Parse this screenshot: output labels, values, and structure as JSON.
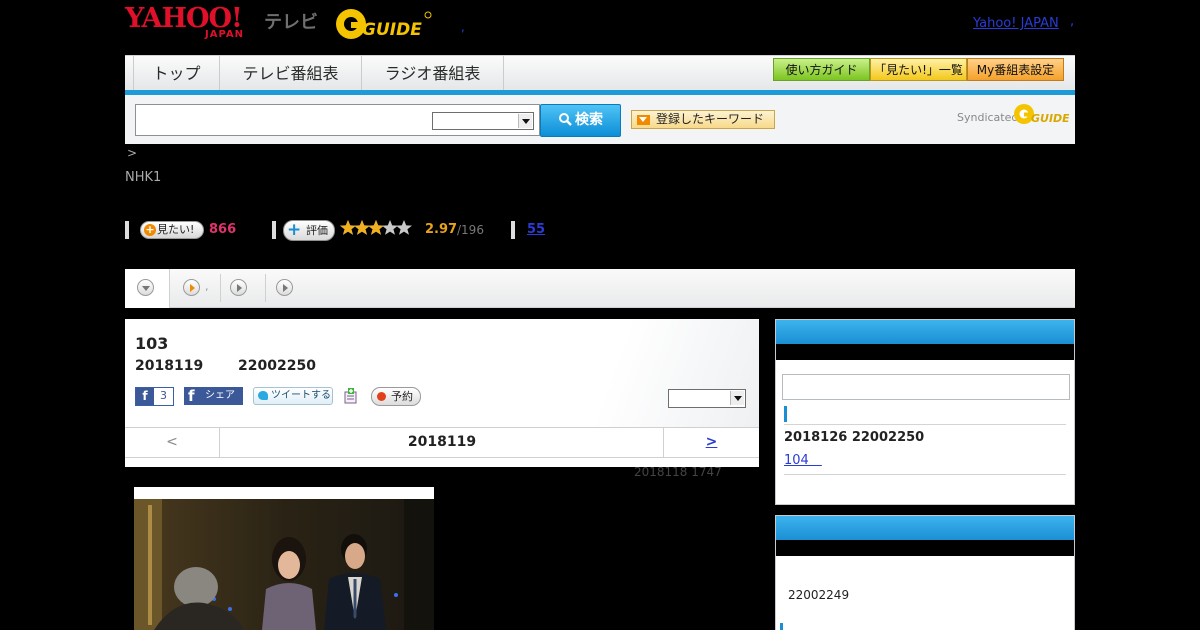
{
  "header": {
    "logo_yahoo": "YAHOO!",
    "logo_japan": "JAPAN",
    "logo_tv": "テレビ",
    "logo_gguide": "GUIDE",
    "yahoo_japan_link": "Yahoo! JAPAN",
    "mid_dot": ",",
    "end_dot": ","
  },
  "nav": {
    "tabs": [
      "トップ",
      "テレビ番組表",
      "ラジオ番組表"
    ],
    "buttons": [
      "使い方ガイド",
      "「見たい!」一覧",
      "My番組表設定"
    ]
  },
  "search": {
    "input_value": "",
    "select_value": "",
    "button_label": "検索",
    "keyword_button": "登録したキーワード",
    "syndicated": "Syndicated",
    "syn_guide": "GUIDE"
  },
  "breadcrumb": ">",
  "channel": "NHK1",
  "stats": {
    "mitai_label": "見たい!",
    "mitai_count": "866",
    "rate_label": "評価",
    "rating_fraction": 0.594,
    "rating_value": "2.97",
    "rating_count": "/196",
    "review_count": "55"
  },
  "tabs": {
    "dot": ","
  },
  "program": {
    "title": "103",
    "date": "2018119",
    "time": "22002250",
    "fb_count": "3",
    "fb_f": "f",
    "fb_share": "シェア",
    "tweet": "ツイートする",
    "reserve": "予約",
    "select_value": "",
    "pager_prev": "<",
    "pager_date": "2018119",
    "pager_next": ">",
    "updated": "2018118  1747"
  },
  "sidebar": {
    "box1": {
      "input_value": "",
      "next_date": "2018126  22002250",
      "next_link": "104　"
    },
    "box2": {
      "time": "22002249"
    }
  },
  "colors": {
    "accent_blue": "#1e9ad8",
    "link": "#2a3bd6",
    "mitai_pink": "#e0336e",
    "rating_orange": "#e8a11a"
  }
}
